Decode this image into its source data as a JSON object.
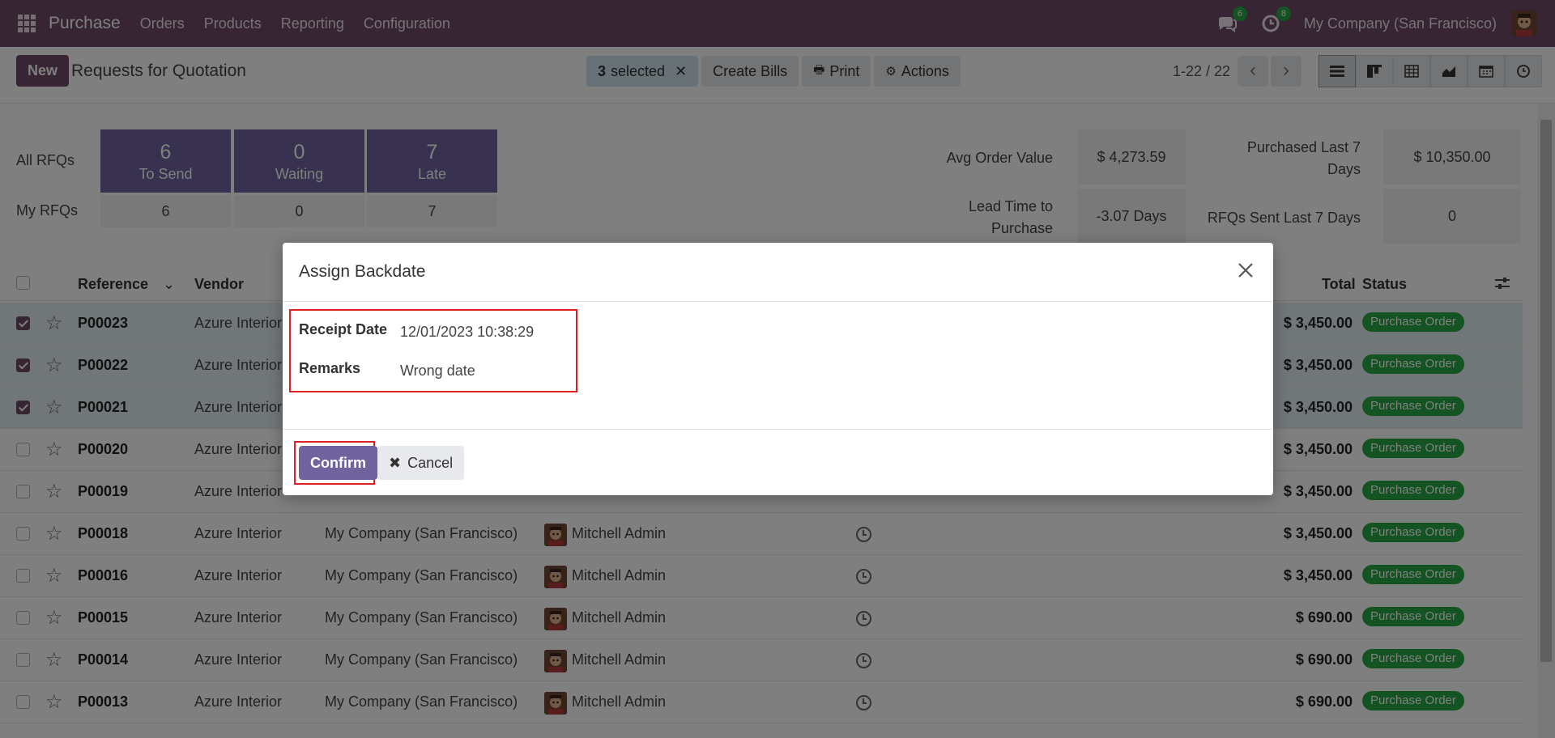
{
  "navbar": {
    "app_name": "Purchase",
    "menu": [
      "Orders",
      "Products",
      "Reporting",
      "Configuration"
    ],
    "messages_count": "6",
    "activities_count": "8",
    "company": "My Company (San Francisco)"
  },
  "control": {
    "new_label": "New",
    "title": "Requests for Quotation",
    "selected_count": "3",
    "selected_label": "selected",
    "create_bills": "Create Bills",
    "print": "Print",
    "actions": "Actions",
    "pager": "1-22 / 22"
  },
  "dashboard": {
    "all_rfqs": "All RFQs",
    "my_rfqs": "My RFQs",
    "tiles": [
      {
        "num": "6",
        "label": "To Send",
        "mine": "6"
      },
      {
        "num": "0",
        "label": "Waiting",
        "mine": "0"
      },
      {
        "num": "7",
        "label": "Late",
        "mine": "7"
      }
    ],
    "stats": {
      "avg_order_label": "Avg Order Value",
      "avg_order_value": "$ 4,273.59",
      "purchased_label": "Purchased Last 7 Days",
      "purchased_value": "$ 10,350.00",
      "lead_time_label": "Lead Time to Purchase",
      "lead_time_value": "-3.07 Days",
      "rfqs_sent_label": "RFQs Sent Last 7 Days",
      "rfqs_sent_value": "0"
    }
  },
  "table": {
    "headers": {
      "reference": "Reference",
      "vendor": "Vendor",
      "total": "Total",
      "status": "Status"
    },
    "rows": [
      {
        "ref": "P00023",
        "vendor": "Azure Interior",
        "company": "",
        "buyer": "",
        "total": "$ 3,450.00",
        "status": "Purchase Order",
        "selected": true
      },
      {
        "ref": "P00022",
        "vendor": "Azure Interior",
        "company": "",
        "buyer": "",
        "total": "$ 3,450.00",
        "status": "Purchase Order",
        "selected": true
      },
      {
        "ref": "P00021",
        "vendor": "Azure Interior",
        "company": "",
        "buyer": "",
        "total": "$ 3,450.00",
        "status": "Purchase Order",
        "selected": true
      },
      {
        "ref": "P00020",
        "vendor": "Azure Interior",
        "company": "",
        "buyer": "",
        "total": "$ 3,450.00",
        "status": "Purchase Order",
        "selected": false
      },
      {
        "ref": "P00019",
        "vendor": "Azure Interior",
        "company": "",
        "buyer": "",
        "total": "$ 3,450.00",
        "status": "Purchase Order",
        "selected": false
      },
      {
        "ref": "P00018",
        "vendor": "Azure Interior",
        "company": "My Company (San Francisco)",
        "buyer": "Mitchell Admin",
        "total": "$ 3,450.00",
        "status": "Purchase Order",
        "selected": false
      },
      {
        "ref": "P00016",
        "vendor": "Azure Interior",
        "company": "My Company (San Francisco)",
        "buyer": "Mitchell Admin",
        "total": "$ 3,450.00",
        "status": "Purchase Order",
        "selected": false
      },
      {
        "ref": "P00015",
        "vendor": "Azure Interior",
        "company": "My Company (San Francisco)",
        "buyer": "Mitchell Admin",
        "total": "$ 690.00",
        "status": "Purchase Order",
        "selected": false
      },
      {
        "ref": "P00014",
        "vendor": "Azure Interior",
        "company": "My Company (San Francisco)",
        "buyer": "Mitchell Admin",
        "total": "$ 690.00",
        "status": "Purchase Order",
        "selected": false
      },
      {
        "ref": "P00013",
        "vendor": "Azure Interior",
        "company": "My Company (San Francisco)",
        "buyer": "Mitchell Admin",
        "total": "$ 690.00",
        "status": "Purchase Order",
        "selected": false
      }
    ]
  },
  "modal": {
    "title": "Assign Backdate",
    "receipt_date_label": "Receipt Date",
    "receipt_date_value": "12/01/2023 10:38:29",
    "remarks_label": "Remarks",
    "remarks_value": "Wrong date",
    "confirm": "Confirm",
    "cancel": "Cancel"
  },
  "colors": {
    "navbar": "#714b67",
    "tile": "#71639e",
    "status_green": "#28a745",
    "highlight_red": "#e02020"
  },
  "icons": [
    "apps-grid-icon",
    "chat-icon",
    "activity-clock-icon",
    "list-view-icon",
    "kanban-view-icon",
    "pivot-view-icon",
    "graph-view-icon",
    "calendar-view-icon",
    "activity-view-icon",
    "star-icon",
    "clock-icon",
    "close-icon",
    "settings-sliders-icon"
  ]
}
